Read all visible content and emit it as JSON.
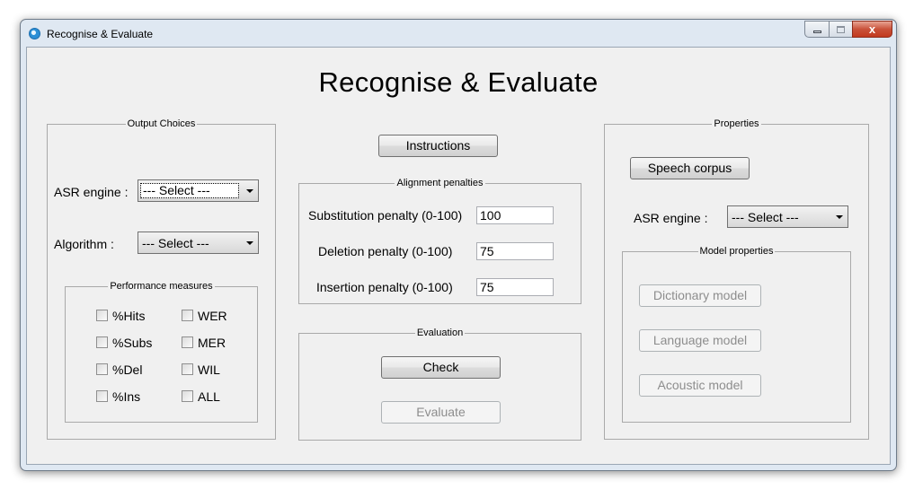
{
  "window": {
    "title": "Recognise & Evaluate",
    "close_glyph": "x"
  },
  "heading": "Recognise & Evaluate",
  "output_choices": {
    "legend": "Output Choices",
    "asr_label": "ASR engine :",
    "asr_value": "--- Select ---",
    "algorithm_label": "Algorithm :",
    "algorithm_value": "--- Select ---",
    "performance": {
      "legend": "Performance measures",
      "items": [
        "%Hits",
        "WER",
        "%Subs",
        "MER",
        "%Del",
        "WIL",
        "%Ins",
        "ALL"
      ]
    }
  },
  "instructions_label": "Instructions",
  "alignment": {
    "legend": "Alignment penalties",
    "substitution_label": "Substitution penalty (0-100)",
    "substitution_value": "100",
    "deletion_label": "Deletion penalty (0-100)",
    "deletion_value": "75",
    "insertion_label": "Insertion penalty (0-100)",
    "insertion_value": "75"
  },
  "evaluation": {
    "legend": "Evaluation",
    "check_label": "Check",
    "evaluate_label": "Evaluate"
  },
  "properties": {
    "legend": "Properties",
    "speech_corpus_label": "Speech corpus",
    "asr_label": "ASR engine :",
    "asr_value": "--- Select ---",
    "model": {
      "legend": "Model properties",
      "dictionary_label": "Dictionary model",
      "language_label": "Language model",
      "acoustic_label": "Acoustic model"
    }
  }
}
